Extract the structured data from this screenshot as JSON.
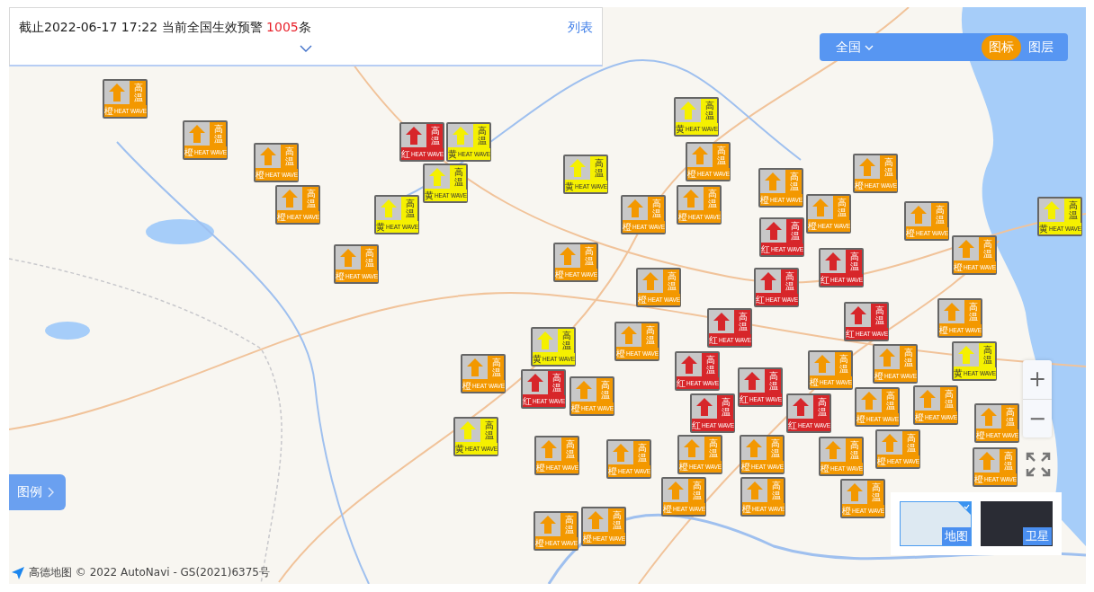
{
  "summary": {
    "text_before": "截止2022-06-17 17:22 当前全国生效预警 ",
    "count": "1005",
    "text_after": "条",
    "link": "列表"
  },
  "toolbar": {
    "region": "全国",
    "tabs": [
      {
        "label": "图标",
        "selected": true
      },
      {
        "label": "图层",
        "selected": false
      }
    ]
  },
  "legend_button": "图例",
  "zoom": {
    "in": "+",
    "out": "−"
  },
  "map_types": [
    {
      "label": "地图",
      "selected": true
    },
    {
      "label": "卫星",
      "selected": false
    }
  ],
  "attribution": "高德地图 © 2022 AutoNavi - GS(2021)6375号",
  "warnings": [
    {
      "grade": "橙",
      "label": "高温",
      "caption": "HEAT WAVE",
      "color": "#f39800"
    },
    {
      "grade": "黄",
      "label": "高温",
      "caption": "HEAT WAVE",
      "color": "#f5f000"
    },
    {
      "grade": "橙",
      "label": "高温",
      "caption": "HEAT WAVE",
      "color": "#f39800"
    },
    {
      "grade": "红",
      "label": "高温",
      "caption": "HEAT WAVE",
      "color": "#d7262a"
    },
    {
      "grade": "黄",
      "label": "高温",
      "caption": "HEAT WAVE",
      "color": "#f5f000"
    },
    {
      "grade": "橙",
      "label": "高温",
      "caption": "HEAT WAVE",
      "color": "#f39800"
    },
    {
      "grade": "橙",
      "label": "高温",
      "caption": "HEAT WAVE",
      "color": "#f39800"
    },
    {
      "grade": "黄",
      "label": "高温",
      "caption": "HEAT WAVE",
      "color": "#f5f000"
    },
    {
      "grade": "橙",
      "label": "高温",
      "caption": "HEAT WAVE",
      "color": "#f39800"
    },
    {
      "grade": "黄",
      "label": "高温",
      "caption": "HEAT WAVE",
      "color": "#f5f000"
    },
    {
      "grade": "橙",
      "label": "高温",
      "caption": "HEAT WAVE",
      "color": "#f39800"
    },
    {
      "grade": "橙",
      "label": "高温",
      "caption": "HEAT WAVE",
      "color": "#f39800"
    },
    {
      "grade": "橙",
      "label": "高温",
      "caption": "HEAT WAVE",
      "color": "#f39800"
    },
    {
      "grade": "黄",
      "label": "高温",
      "caption": "HEAT WAVE",
      "color": "#f5f000"
    },
    {
      "grade": "橙",
      "label": "高温",
      "caption": "HEAT WAVE",
      "color": "#f39800"
    },
    {
      "grade": "橙",
      "label": "高温",
      "caption": "HEAT WAVE",
      "color": "#f39800"
    },
    {
      "grade": "橙",
      "label": "高温",
      "caption": "HEAT WAVE",
      "color": "#f39800"
    },
    {
      "grade": "黄",
      "label": "高温",
      "caption": "HEAT WAVE",
      "color": "#f5f000"
    },
    {
      "grade": "红",
      "label": "高温",
      "caption": "HEAT WAVE",
      "color": "#d7262a"
    },
    {
      "grade": "橙",
      "label": "高温",
      "caption": "HEAT WAVE",
      "color": "#f39800"
    },
    {
      "grade": "橙",
      "label": "高温",
      "caption": "HEAT WAVE",
      "color": "#f39800"
    },
    {
      "grade": "红",
      "label": "高温",
      "caption": "HEAT WAVE",
      "color": "#d7262a"
    },
    {
      "grade": "橙",
      "label": "高温",
      "caption": "HEAT WAVE",
      "color": "#f39800"
    },
    {
      "grade": "橙",
      "label": "高温",
      "caption": "HEAT WAVE",
      "color": "#f39800"
    },
    {
      "grade": "红",
      "label": "高温",
      "caption": "HEAT WAVE",
      "color": "#d7262a"
    },
    {
      "grade": "红",
      "label": "高温",
      "caption": "HEAT WAVE",
      "color": "#d7262a"
    },
    {
      "grade": "红",
      "label": "高温",
      "caption": "HEAT WAVE",
      "color": "#d7262a"
    },
    {
      "grade": "黄",
      "label": "高温",
      "caption": "HEAT WAVE",
      "color": "#f5f000"
    },
    {
      "grade": "橙",
      "label": "高温",
      "caption": "HEAT WAVE",
      "color": "#f39800"
    },
    {
      "grade": "橙",
      "label": "高温",
      "caption": "HEAT WAVE",
      "color": "#f39800"
    },
    {
      "grade": "红",
      "label": "高温",
      "caption": "HEAT WAVE",
      "color": "#d7262a"
    },
    {
      "grade": "橙",
      "label": "高温",
      "caption": "HEAT WAVE",
      "color": "#f39800"
    },
    {
      "grade": "橙",
      "label": "高温",
      "caption": "HEAT WAVE",
      "color": "#f39800"
    },
    {
      "grade": "黄",
      "label": "高温",
      "caption": "HEAT WAVE",
      "color": "#f5f000"
    },
    {
      "grade": "红",
      "label": "高温",
      "caption": "HEAT WAVE",
      "color": "#d7262a"
    },
    {
      "grade": "红",
      "label": "高温",
      "caption": "HEAT WAVE",
      "color": "#d7262a"
    },
    {
      "grade": "橙",
      "label": "高温",
      "caption": "HEAT WAVE",
      "color": "#f39800"
    },
    {
      "grade": "橙",
      "label": "高温",
      "caption": "HEAT WAVE",
      "color": "#f39800"
    },
    {
      "grade": "橙",
      "label": "高温",
      "caption": "HEAT WAVE",
      "color": "#f39800"
    },
    {
      "grade": "红",
      "label": "高温",
      "caption": "HEAT WAVE",
      "color": "#d7262a"
    },
    {
      "grade": "红",
      "label": "高温",
      "caption": "HEAT WAVE",
      "color": "#d7262a"
    },
    {
      "grade": "橙",
      "label": "高温",
      "caption": "HEAT WAVE",
      "color": "#f39800"
    },
    {
      "grade": "黄",
      "label": "高温",
      "caption": "HEAT WAVE",
      "color": "#f5f000"
    },
    {
      "grade": "橙",
      "label": "高温",
      "caption": "HEAT WAVE",
      "color": "#f39800"
    },
    {
      "grade": "橙",
      "label": "高温",
      "caption": "HEAT WAVE",
      "color": "#f39800"
    },
    {
      "grade": "橙",
      "label": "高温",
      "caption": "HEAT WAVE",
      "color": "#f39800"
    },
    {
      "grade": "橙",
      "label": "高温",
      "caption": "HEAT WAVE",
      "color": "#f39800"
    },
    {
      "grade": "橙",
      "label": "高温",
      "caption": "HEAT WAVE",
      "color": "#f39800"
    },
    {
      "grade": "橙",
      "label": "高温",
      "caption": "HEAT WAVE",
      "color": "#f39800"
    },
    {
      "grade": "橙",
      "label": "高温",
      "caption": "HEAT WAVE",
      "color": "#f39800"
    },
    {
      "grade": "橙",
      "label": "高温",
      "caption": "HEAT WAVE",
      "color": "#f39800"
    },
    {
      "grade": "橙",
      "label": "高温",
      "caption": "HEAT WAVE",
      "color": "#f39800"
    },
    {
      "grade": "橙",
      "label": "高温",
      "caption": "HEAT WAVE",
      "color": "#f39800"
    },
    {
      "grade": "橙",
      "label": "高温",
      "caption": "HEAT WAVE",
      "color": "#f39800"
    },
    {
      "grade": "橙",
      "label": "高温",
      "caption": "HEAT WAVE",
      "color": "#f39800"
    },
    {
      "grade": "橙",
      "label": "高温",
      "caption": "HEAT WAVE",
      "color": "#f39800"
    }
  ]
}
